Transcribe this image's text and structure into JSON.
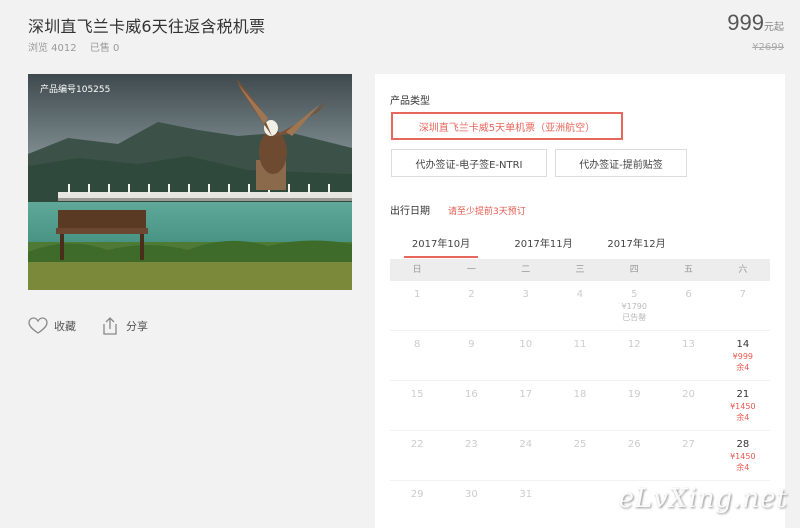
{
  "product": {
    "title": "深圳直飞兰卡威6天往返含税机票",
    "views": "浏览 4012",
    "sold": "已售 0",
    "price": "999",
    "price_unit": "元起",
    "old_price": "¥2699",
    "code": "产品编号105255"
  },
  "actions": {
    "favorite": "收藏",
    "share": "分享"
  },
  "panel": {
    "type_label": "产品类型",
    "options": [
      "深圳直飞兰卡威5天单机票（亚洲航空）",
      "代办签证-电子签E-NTRI",
      "代办签证-提前贴签"
    ],
    "date_label": "出行日期",
    "date_warn": "请至少提前3天预订",
    "tabs": [
      "2017年10月",
      "2017年11月",
      "2017年12月"
    ]
  },
  "calendar": {
    "weekdays": [
      "日",
      "一",
      "二",
      "三",
      "四",
      "五",
      "六"
    ],
    "weeks": [
      [
        {
          "d": "1"
        },
        {
          "d": "2"
        },
        {
          "d": "3"
        },
        {
          "d": "4"
        },
        {
          "d": "5",
          "p": "¥1790",
          "s": "已告罄",
          "sold": true
        },
        {
          "d": "6"
        },
        {
          "d": "7"
        }
      ],
      [
        {
          "d": "8"
        },
        {
          "d": "9"
        },
        {
          "d": "10"
        },
        {
          "d": "11"
        },
        {
          "d": "12"
        },
        {
          "d": "13"
        },
        {
          "d": "14",
          "p": "¥999",
          "s": "余4",
          "avail": true
        }
      ],
      [
        {
          "d": "15"
        },
        {
          "d": "16"
        },
        {
          "d": "17"
        },
        {
          "d": "18"
        },
        {
          "d": "19"
        },
        {
          "d": "20"
        },
        {
          "d": "21",
          "p": "¥1450",
          "s": "余4",
          "avail": true
        }
      ],
      [
        {
          "d": "22"
        },
        {
          "d": "23"
        },
        {
          "d": "24"
        },
        {
          "d": "25"
        },
        {
          "d": "26"
        },
        {
          "d": "27"
        },
        {
          "d": "28",
          "p": "¥1450",
          "s": "余4",
          "avail": true
        }
      ],
      [
        {
          "d": "29"
        },
        {
          "d": "30"
        },
        {
          "d": "31"
        },
        {
          "d": ""
        },
        {
          "d": ""
        },
        {
          "d": ""
        },
        {
          "d": ""
        }
      ]
    ]
  },
  "watermark": "eLvXing.net",
  "colors": {
    "accent": "#e8675c",
    "price_red": "#e85a4f"
  },
  "icons": {
    "favorite": "heart-icon",
    "share": "share-icon"
  }
}
